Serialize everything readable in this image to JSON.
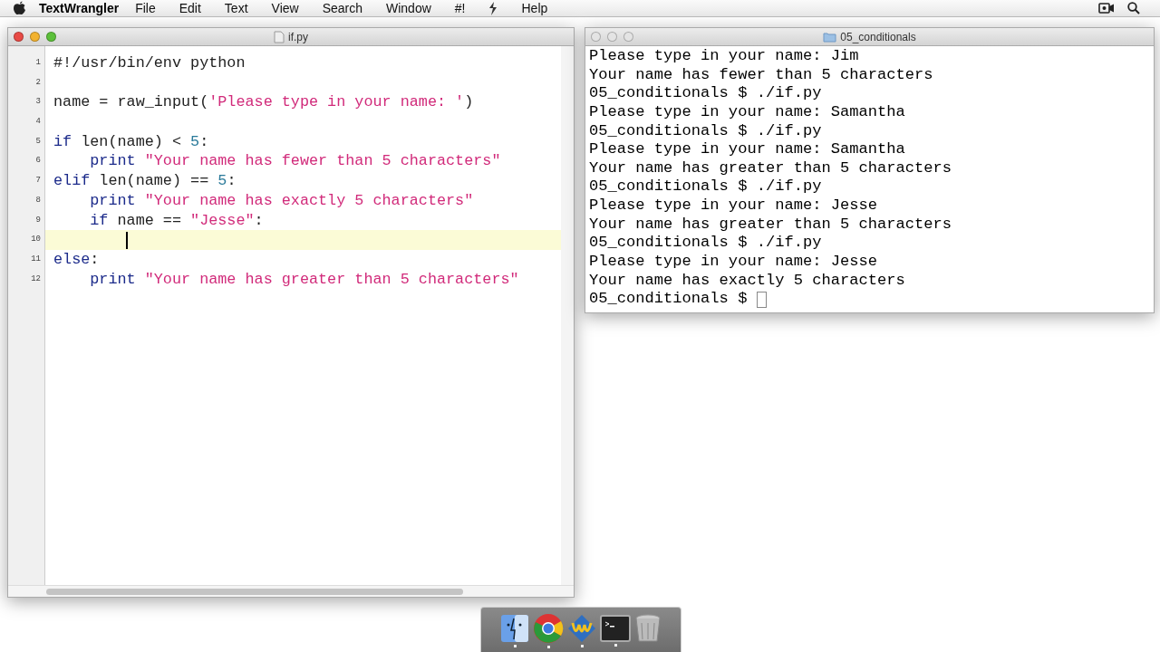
{
  "menu_bar": {
    "app_name": "TextWrangler",
    "menus": [
      "File",
      "Edit",
      "Text",
      "View",
      "Search",
      "Window",
      "#!",
      "Help"
    ]
  },
  "editor": {
    "title": "if.py",
    "lines": [
      {
        "number": "1",
        "current": false,
        "tokens": [
          {
            "text": "#!/usr/bin/env python",
            "kind": "plain"
          }
        ]
      },
      {
        "number": "2",
        "current": false
      },
      {
        "number": "3",
        "current": false,
        "tokens": [
          {
            "text": "name = raw_input(",
            "kind": "plain"
          },
          {
            "text": "'Please type in your name: '",
            "kind": "string"
          },
          {
            "text": ")",
            "kind": "plain"
          }
        ]
      },
      {
        "number": "4",
        "current": false
      },
      {
        "number": "5",
        "current": false,
        "tokens": [
          {
            "text": "if",
            "kind": "keyword"
          },
          {
            "text": " len(name) < ",
            "kind": "plain"
          },
          {
            "text": "5",
            "kind": "number"
          },
          {
            "text": ":",
            "kind": "plain"
          }
        ]
      },
      {
        "number": "6",
        "current": false,
        "tokens": [
          {
            "text": "    print",
            "kind": "keyword"
          },
          {
            "text": " \"Your name has fewer than 5 characters\"",
            "kind": "string"
          }
        ]
      },
      {
        "number": "7",
        "current": false,
        "tokens": [
          {
            "text": "elif",
            "kind": "keyword"
          },
          {
            "text": " len(name) == ",
            "kind": "plain"
          },
          {
            "text": "5",
            "kind": "number"
          },
          {
            "text": ":",
            "kind": "plain"
          }
        ]
      },
      {
        "number": "8",
        "current": false,
        "tokens": [
          {
            "text": "    print",
            "kind": "keyword"
          },
          {
            "text": " \"Your name has exactly 5 characters\"",
            "kind": "string"
          }
        ]
      },
      {
        "number": "9",
        "current": false,
        "tokens": [
          {
            "text": "    if",
            "kind": "keyword"
          },
          {
            "text": " name == ",
            "kind": "plain"
          },
          {
            "text": "\"Jesse\"",
            "kind": "string"
          },
          {
            "text": ":",
            "kind": "plain"
          }
        ]
      },
      {
        "number": "10",
        "current": true
      },
      {
        "number": "11",
        "current": false,
        "tokens": [
          {
            "text": "else",
            "kind": "keyword"
          },
          {
            "text": ":",
            "kind": "plain"
          }
        ]
      },
      {
        "number": "12",
        "current": false,
        "tokens": [
          {
            "text": "    print",
            "kind": "keyword"
          },
          {
            "text": " \"Your name has greater than 5 characters\"",
            "kind": "string"
          }
        ]
      }
    ]
  },
  "terminal": {
    "title": "05_conditionals",
    "lines": [
      "Please type in your name: Jim",
      "Your name has fewer than 5 characters",
      "05_conditionals $ ./if.py",
      "Please type in your name: Samantha",
      "05_conditionals $ ./if.py",
      "Please type in your name: Samantha",
      "Your name has greater than 5 characters",
      "05_conditionals $ ./if.py",
      "Please type in your name: Jesse",
      "Your name has greater than 5 characters",
      "05_conditionals $ ./if.py",
      "Please type in your name: Jesse",
      "Your name has exactly 5 characters",
      "05_conditionals $ "
    ]
  },
  "dock": [
    {
      "kind": "finder",
      "running": true
    },
    {
      "kind": "chrome",
      "running": true
    },
    {
      "kind": "textwrangler",
      "running": true
    },
    {
      "kind": "terminal",
      "running": true
    },
    {
      "kind": "trash",
      "running": false
    }
  ]
}
